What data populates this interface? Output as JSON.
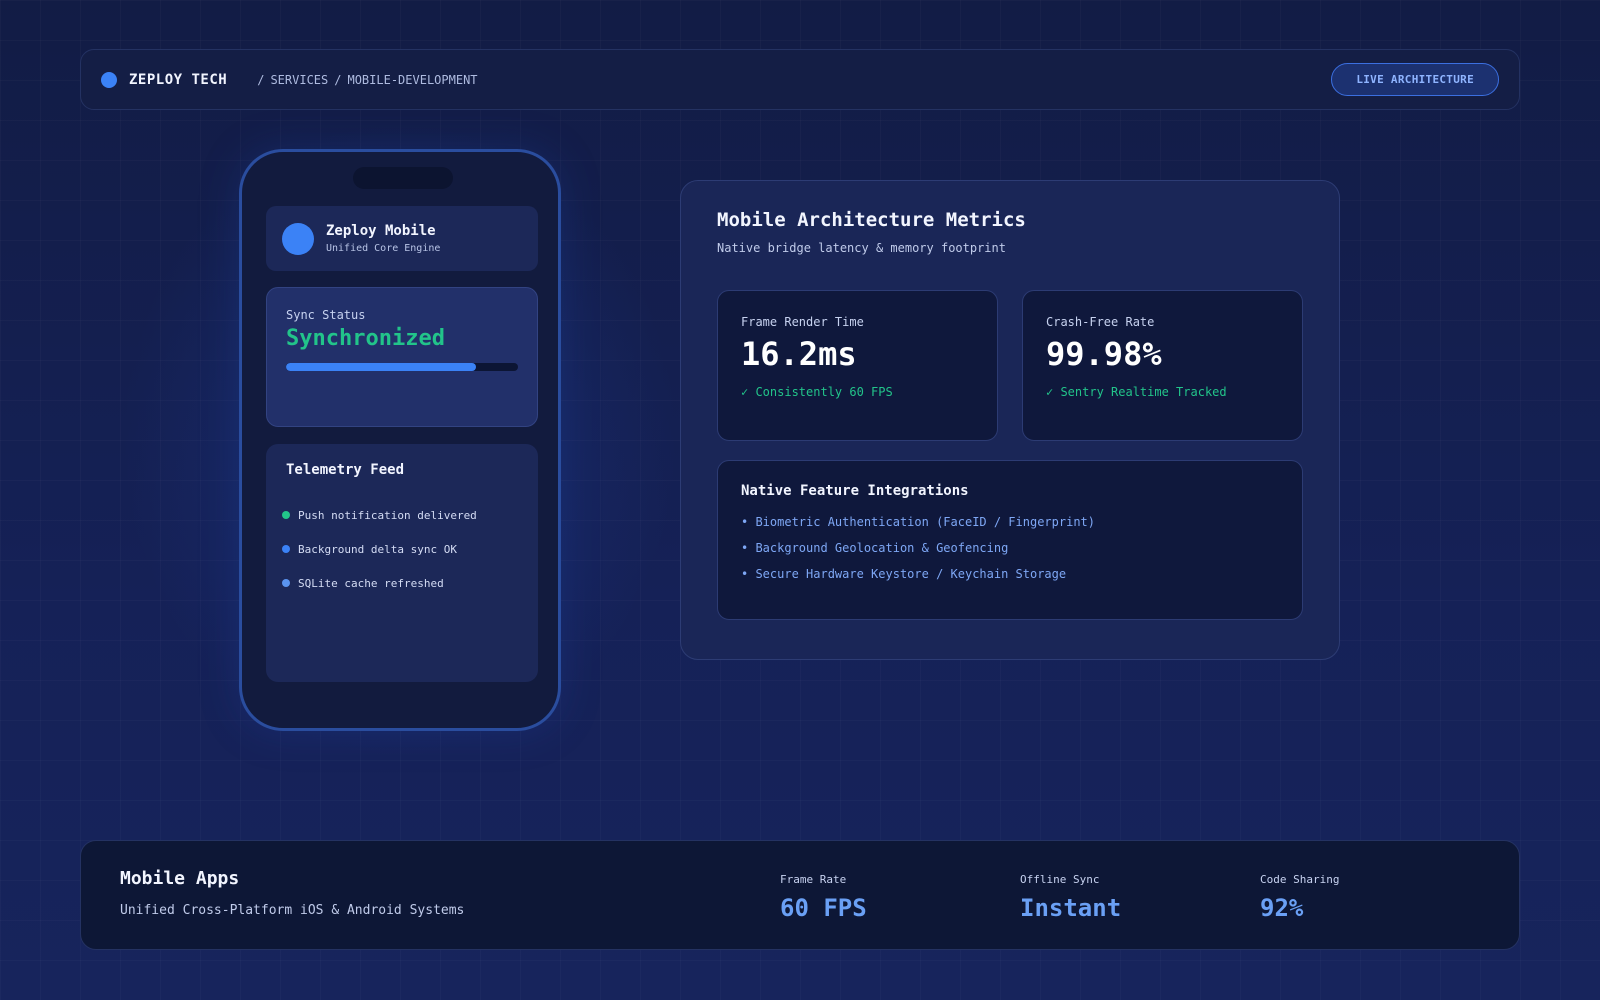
{
  "colors": {
    "accent": "#3b82f6",
    "success": "#22c48a",
    "link": "#7ea7f5",
    "background": "#131d4a"
  },
  "header": {
    "brand_icon": "brand-dot-icon",
    "brand": "ZEPLOY TECH",
    "breadcrumb": [
      "/",
      "SERVICES",
      "/",
      "MOBILE-DEVELOPMENT"
    ],
    "cta_label": "LIVE ARCHITECTURE"
  },
  "phone": {
    "app": {
      "title": "Zeploy Mobile",
      "subtitle": "Unified Core Engine"
    },
    "sync": {
      "label": "Sync Status",
      "value": "Synchronized",
      "progress_percent": 82
    },
    "telemetry": {
      "title": "Telemetry Feed",
      "items": [
        {
          "text": "Push notification delivered",
          "dot_color": "#22c48a"
        },
        {
          "text": "Background delta sync OK",
          "dot_color": "#3b82f6"
        },
        {
          "text": "SQLite cache refreshed",
          "dot_color": "#5a94f0"
        }
      ]
    }
  },
  "metrics": {
    "title": "Mobile Architecture Metrics",
    "subtitle": "Native bridge latency & memory footprint",
    "cards": [
      {
        "label": "Frame Render Time",
        "value": "16.2ms",
        "note": "✓ Consistently 60 FPS"
      },
      {
        "label": "Crash-Free Rate",
        "value": "99.98%",
        "note": "✓ Sentry Realtime Tracked"
      }
    ],
    "features": {
      "title": "Native Feature Integrations",
      "items": [
        "• Biometric Authentication (FaceID / Fingerprint)",
        "• Background Geolocation & Geofencing",
        "• Secure Hardware Keystore / Keychain Storage"
      ]
    }
  },
  "footer": {
    "title": "Mobile Apps",
    "subtitle": "Unified Cross-Platform iOS & Android Systems",
    "stats": [
      {
        "label": "Frame Rate",
        "value": "60 FPS"
      },
      {
        "label": "Offline Sync",
        "value": "Instant"
      },
      {
        "label": "Code Sharing",
        "value": "92%"
      }
    ]
  }
}
